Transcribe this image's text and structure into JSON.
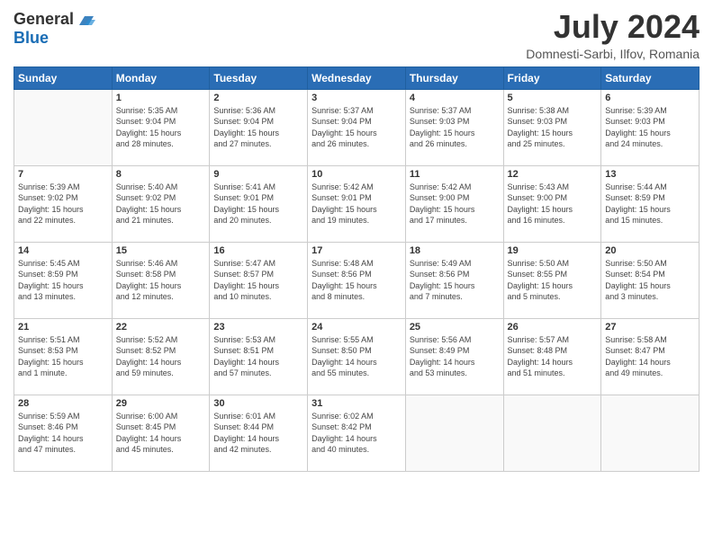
{
  "header": {
    "logo": {
      "general": "General",
      "blue": "Blue"
    },
    "month": "July 2024",
    "location": "Domnesti-Sarbi, Ilfov, Romania"
  },
  "weekdays": [
    "Sunday",
    "Monday",
    "Tuesday",
    "Wednesday",
    "Thursday",
    "Friday",
    "Saturday"
  ],
  "weeks": [
    [
      {
        "day": "",
        "info": ""
      },
      {
        "day": "1",
        "info": "Sunrise: 5:35 AM\nSunset: 9:04 PM\nDaylight: 15 hours\nand 28 minutes."
      },
      {
        "day": "2",
        "info": "Sunrise: 5:36 AM\nSunset: 9:04 PM\nDaylight: 15 hours\nand 27 minutes."
      },
      {
        "day": "3",
        "info": "Sunrise: 5:37 AM\nSunset: 9:04 PM\nDaylight: 15 hours\nand 26 minutes."
      },
      {
        "day": "4",
        "info": "Sunrise: 5:37 AM\nSunset: 9:03 PM\nDaylight: 15 hours\nand 26 minutes."
      },
      {
        "day": "5",
        "info": "Sunrise: 5:38 AM\nSunset: 9:03 PM\nDaylight: 15 hours\nand 25 minutes."
      },
      {
        "day": "6",
        "info": "Sunrise: 5:39 AM\nSunset: 9:03 PM\nDaylight: 15 hours\nand 24 minutes."
      }
    ],
    [
      {
        "day": "7",
        "info": "Sunrise: 5:39 AM\nSunset: 9:02 PM\nDaylight: 15 hours\nand 22 minutes."
      },
      {
        "day": "8",
        "info": "Sunrise: 5:40 AM\nSunset: 9:02 PM\nDaylight: 15 hours\nand 21 minutes."
      },
      {
        "day": "9",
        "info": "Sunrise: 5:41 AM\nSunset: 9:01 PM\nDaylight: 15 hours\nand 20 minutes."
      },
      {
        "day": "10",
        "info": "Sunrise: 5:42 AM\nSunset: 9:01 PM\nDaylight: 15 hours\nand 19 minutes."
      },
      {
        "day": "11",
        "info": "Sunrise: 5:42 AM\nSunset: 9:00 PM\nDaylight: 15 hours\nand 17 minutes."
      },
      {
        "day": "12",
        "info": "Sunrise: 5:43 AM\nSunset: 9:00 PM\nDaylight: 15 hours\nand 16 minutes."
      },
      {
        "day": "13",
        "info": "Sunrise: 5:44 AM\nSunset: 8:59 PM\nDaylight: 15 hours\nand 15 minutes."
      }
    ],
    [
      {
        "day": "14",
        "info": "Sunrise: 5:45 AM\nSunset: 8:59 PM\nDaylight: 15 hours\nand 13 minutes."
      },
      {
        "day": "15",
        "info": "Sunrise: 5:46 AM\nSunset: 8:58 PM\nDaylight: 15 hours\nand 12 minutes."
      },
      {
        "day": "16",
        "info": "Sunrise: 5:47 AM\nSunset: 8:57 PM\nDaylight: 15 hours\nand 10 minutes."
      },
      {
        "day": "17",
        "info": "Sunrise: 5:48 AM\nSunset: 8:56 PM\nDaylight: 15 hours\nand 8 minutes."
      },
      {
        "day": "18",
        "info": "Sunrise: 5:49 AM\nSunset: 8:56 PM\nDaylight: 15 hours\nand 7 minutes."
      },
      {
        "day": "19",
        "info": "Sunrise: 5:50 AM\nSunset: 8:55 PM\nDaylight: 15 hours\nand 5 minutes."
      },
      {
        "day": "20",
        "info": "Sunrise: 5:50 AM\nSunset: 8:54 PM\nDaylight: 15 hours\nand 3 minutes."
      }
    ],
    [
      {
        "day": "21",
        "info": "Sunrise: 5:51 AM\nSunset: 8:53 PM\nDaylight: 15 hours\nand 1 minute."
      },
      {
        "day": "22",
        "info": "Sunrise: 5:52 AM\nSunset: 8:52 PM\nDaylight: 14 hours\nand 59 minutes."
      },
      {
        "day": "23",
        "info": "Sunrise: 5:53 AM\nSunset: 8:51 PM\nDaylight: 14 hours\nand 57 minutes."
      },
      {
        "day": "24",
        "info": "Sunrise: 5:55 AM\nSunset: 8:50 PM\nDaylight: 14 hours\nand 55 minutes."
      },
      {
        "day": "25",
        "info": "Sunrise: 5:56 AM\nSunset: 8:49 PM\nDaylight: 14 hours\nand 53 minutes."
      },
      {
        "day": "26",
        "info": "Sunrise: 5:57 AM\nSunset: 8:48 PM\nDaylight: 14 hours\nand 51 minutes."
      },
      {
        "day": "27",
        "info": "Sunrise: 5:58 AM\nSunset: 8:47 PM\nDaylight: 14 hours\nand 49 minutes."
      }
    ],
    [
      {
        "day": "28",
        "info": "Sunrise: 5:59 AM\nSunset: 8:46 PM\nDaylight: 14 hours\nand 47 minutes."
      },
      {
        "day": "29",
        "info": "Sunrise: 6:00 AM\nSunset: 8:45 PM\nDaylight: 14 hours\nand 45 minutes."
      },
      {
        "day": "30",
        "info": "Sunrise: 6:01 AM\nSunset: 8:44 PM\nDaylight: 14 hours\nand 42 minutes."
      },
      {
        "day": "31",
        "info": "Sunrise: 6:02 AM\nSunset: 8:42 PM\nDaylight: 14 hours\nand 40 minutes."
      },
      {
        "day": "",
        "info": ""
      },
      {
        "day": "",
        "info": ""
      },
      {
        "day": "",
        "info": ""
      }
    ]
  ]
}
